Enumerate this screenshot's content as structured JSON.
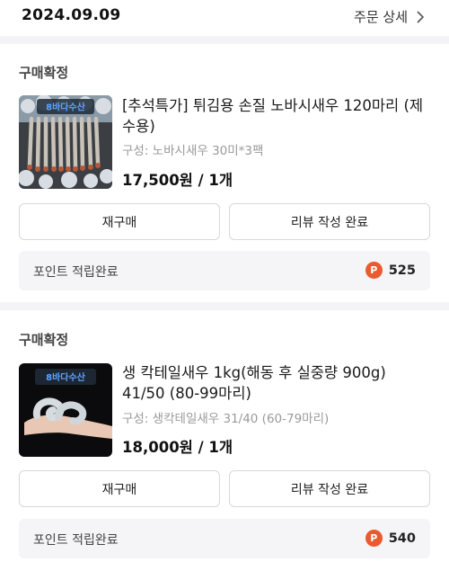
{
  "header": {
    "date": "2024.09.09",
    "order_detail_label": "주문 상세",
    "chevron_icon": "chevron-right-icon"
  },
  "orders": [
    {
      "status": "구매확정",
      "thumb_brand": "8바다수산",
      "product_name": "[추석특가] 튀김용 손질 노바시새우 120마리 (제수용)",
      "spec": "구성: 노바시새우 30미*3팩",
      "price": "17,500원 / 1개",
      "rebuy_label": "재구매",
      "review_label": "리뷰 작성 완료",
      "points_label": "포인트 적립완료",
      "points_icon": "P",
      "points_value": "525"
    },
    {
      "status": "구매확정",
      "thumb_brand": "8바다수산",
      "product_name": "생 칵테일새우 1kg(해동 후 실중량 900g) 41/50 (80-99마리)",
      "spec": "구성: 생칵테일새우 31/40 (60-79마리)",
      "price": "18,000원 / 1개",
      "rebuy_label": "재구매",
      "review_label": "리뷰 작성 완료",
      "points_label": "포인트 적립완료",
      "points_icon": "P",
      "points_value": "540"
    }
  ],
  "colors": {
    "point_badge": "#ea5a30",
    "section_divider": "#f4f4f6",
    "brand_text": "#3f7fd8"
  }
}
